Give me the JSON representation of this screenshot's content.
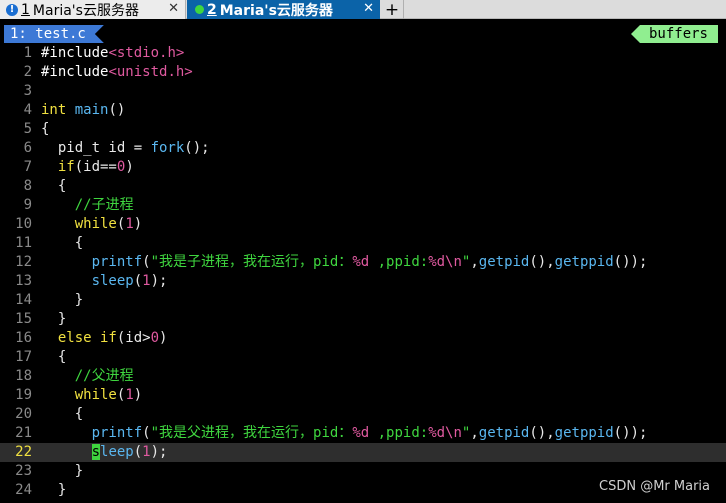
{
  "terminal_tabs": [
    {
      "index": "1",
      "title": "Maria's云服务器",
      "active": false,
      "close": "✕"
    },
    {
      "index": "2",
      "title": "Maria's云服务器",
      "active": true,
      "close": "✕"
    }
  ],
  "add_tab": "+",
  "vim": {
    "tab_label": "1: test.c",
    "buffers_label": "buffers",
    "current_line": 22
  },
  "code_lines": [
    {
      "n": "1"
    },
    {
      "n": "2"
    },
    {
      "n": "3"
    },
    {
      "n": "4"
    },
    {
      "n": "5"
    },
    {
      "n": "6"
    },
    {
      "n": "7"
    },
    {
      "n": "8"
    },
    {
      "n": "9"
    },
    {
      "n": "10"
    },
    {
      "n": "11"
    },
    {
      "n": "12"
    },
    {
      "n": "13"
    },
    {
      "n": "14"
    },
    {
      "n": "15"
    },
    {
      "n": "16"
    },
    {
      "n": "17"
    },
    {
      "n": "18"
    },
    {
      "n": "19"
    },
    {
      "n": "20"
    },
    {
      "n": "21"
    },
    {
      "n": "22"
    },
    {
      "n": "23"
    },
    {
      "n": "24"
    }
  ],
  "tokens": {
    "l1": [
      "#include",
      "<stdio.h>"
    ],
    "l2": [
      "#include",
      "<unistd.h>"
    ],
    "l4": [
      "int",
      " ",
      "main",
      "()"
    ],
    "l5": [
      "{"
    ],
    "l6": [
      "  pid_t id = ",
      "fork",
      "();"
    ],
    "l7": [
      "  ",
      "if",
      "(id==",
      "0",
      ")"
    ],
    "l8": [
      "  {"
    ],
    "l9": [
      "    ",
      "//子进程"
    ],
    "l10": [
      "    ",
      "while",
      "(",
      "1",
      ")"
    ],
    "l11": [
      "    {"
    ],
    "l12": [
      "      ",
      "printf",
      "(",
      "\"我是子进程，我在运行，pid：",
      "%d",
      " ,ppid:",
      "%d",
      "\\n",
      "\"",
      ",",
      "getpid",
      "(),",
      "getppid",
      "());"
    ],
    "l13": [
      "      ",
      "sleep",
      "(",
      "1",
      ");"
    ],
    "l14": [
      "    }"
    ],
    "l15": [
      "  }"
    ],
    "l16": [
      "  ",
      "else if",
      "(id>",
      "0",
      ")"
    ],
    "l17": [
      "  {"
    ],
    "l18": [
      "    ",
      "//父进程"
    ],
    "l19": [
      "    ",
      "while",
      "(",
      "1",
      ")"
    ],
    "l20": [
      "    {"
    ],
    "l21": [
      "      ",
      "printf",
      "(",
      "\"我是父进程，我在运行，pid：",
      "%d",
      " ,ppid:",
      "%d",
      "\\n",
      "\"",
      ",",
      "getpid",
      "(),",
      "getppid",
      "());"
    ],
    "l22": [
      "      ",
      "s",
      "leep",
      "(",
      "1",
      ");"
    ],
    "l23": [
      "    }"
    ],
    "l24": [
      "  }"
    ]
  },
  "watermark": "CSDN @Mr Maria",
  "colors": {
    "keyword": "#f0e040",
    "function": "#5ab7f0",
    "number": "#e05aa0",
    "string": "#3fd63f",
    "comment": "#3fd63f",
    "active_tab": "#0b63a8",
    "vim_tab": "#3d79d6",
    "buffers": "#90ee90"
  }
}
